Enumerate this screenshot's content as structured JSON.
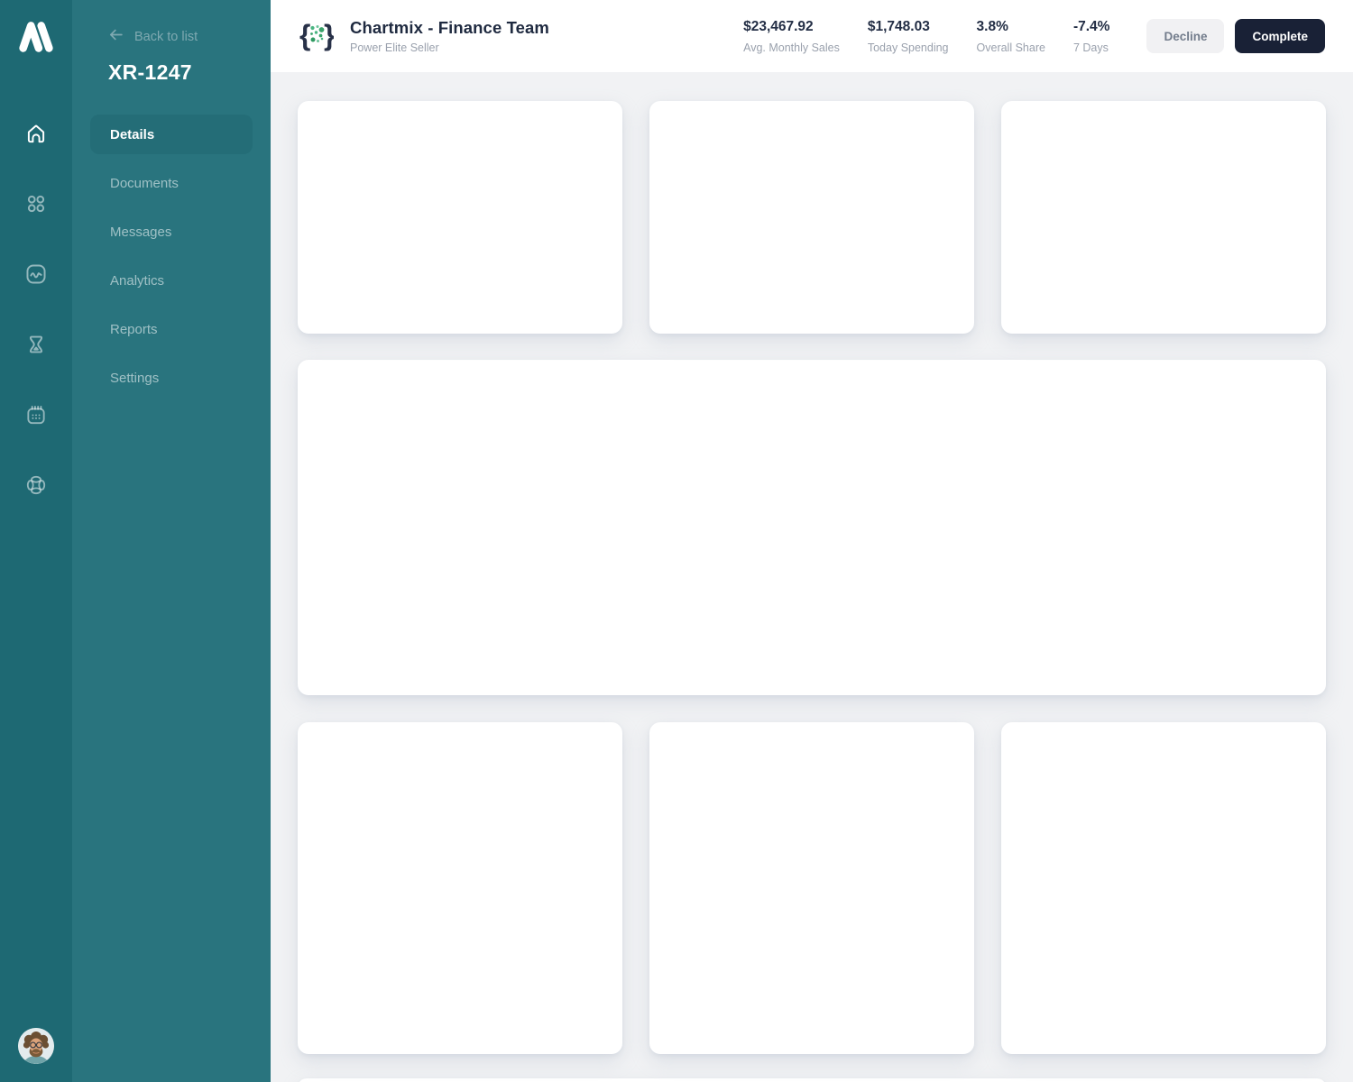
{
  "rail": {
    "icons": [
      {
        "name": "home-icon",
        "active": true
      },
      {
        "name": "grid-icon",
        "active": false
      },
      {
        "name": "activity-icon",
        "active": false
      },
      {
        "name": "hourglass-icon",
        "active": false
      },
      {
        "name": "calendar-icon",
        "active": false
      },
      {
        "name": "lifebuoy-icon",
        "active": false
      }
    ],
    "logo": "m-mountain-logo",
    "avatar": "user-photo"
  },
  "sidebar": {
    "back_label": "Back to list",
    "title": "XR-1247",
    "items": [
      {
        "label": "Details",
        "active": true
      },
      {
        "label": "Documents",
        "active": false
      },
      {
        "label": "Messages",
        "active": false
      },
      {
        "label": "Analytics",
        "active": false
      },
      {
        "label": "Reports",
        "active": false
      },
      {
        "label": "Settings",
        "active": false
      }
    ]
  },
  "header": {
    "logo": "braces-dots-logo",
    "title": "Chartmix - Finance Team",
    "subtitle": "Power Elite Seller",
    "stats": [
      {
        "value": "$23,467.92",
        "label": "Avg. Monthly Sales"
      },
      {
        "value": "$1,748.03",
        "label": "Today Spending"
      },
      {
        "value": "3.8%",
        "label": "Overall Share"
      },
      {
        "value": "-7.4%",
        "label": "7 Days"
      }
    ],
    "buttons": {
      "decline": "Decline",
      "complete": "Complete"
    }
  },
  "colors": {
    "rail_bg": "#1e6973",
    "sidebar_bg": "#29747e",
    "active_item_bg": "#246d77",
    "content_bg": "#f1f2f4",
    "dark_navy": "#192136",
    "accent_green": "#3aa36b"
  }
}
